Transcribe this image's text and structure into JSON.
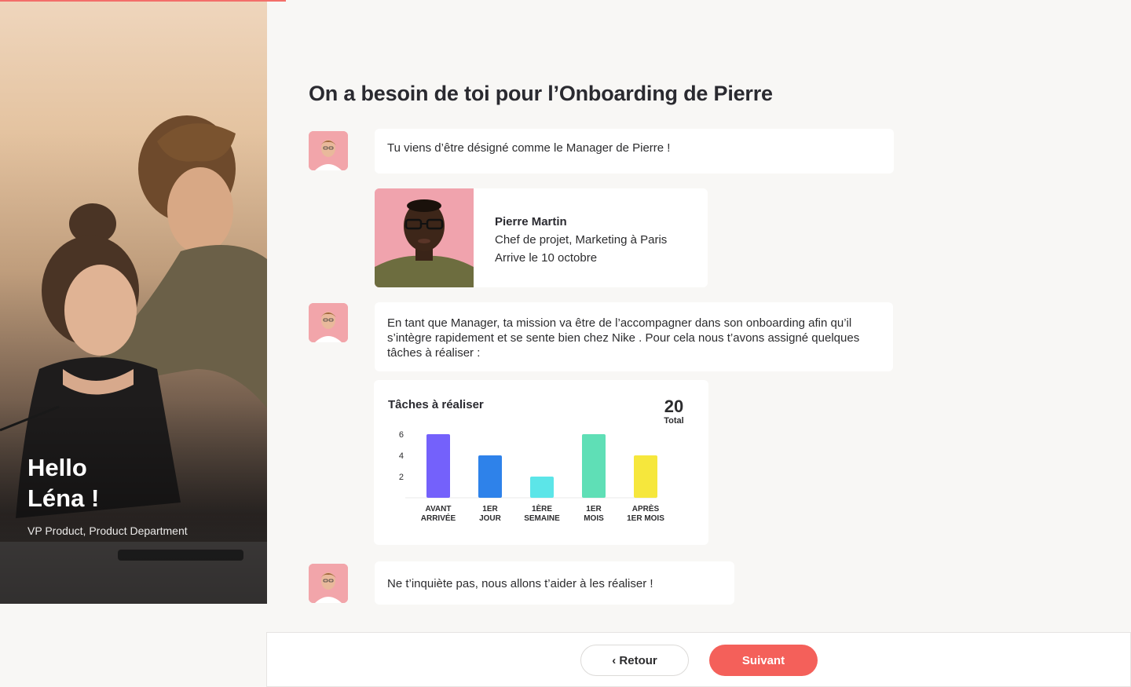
{
  "hero": {
    "greeting_line1": "Hello",
    "greeting_line2": "Léna !",
    "role": "VP Product, Product Department"
  },
  "main": {
    "title": "On a besoin de toi pour l’Onboarding de Pierre",
    "message1": "Tu viens d’être désigné comme le Manager de Pierre !",
    "profile": {
      "name": "Pierre Martin",
      "position": "Chef de projet, Marketing à Paris",
      "arrival": "Arrive le 10 octobre"
    },
    "message2": "En tant que Manager, ta mission va être de l’accompagner dans son onboarding afin qu’il s’intègre rapidement et se sente bien chez Nike . Pour cela nous t’avons assigné quelques tâches à réaliser :",
    "message3": "Ne t’inquiète pas, nous allons t’aider à les réaliser !"
  },
  "chart_card": {
    "title": "Tâches à réaliser",
    "total_value": "20",
    "total_label": "Total"
  },
  "chart_data": {
    "type": "bar",
    "title": "Tâches à réaliser",
    "categories": [
      [
        "AVANT",
        "ARRIVÉE"
      ],
      [
        "1ER",
        "JOUR"
      ],
      [
        "1ÈRE",
        "SEMAINE"
      ],
      [
        "1ER",
        "MOIS"
      ],
      [
        "APRÈS",
        "1ER MOIS"
      ]
    ],
    "values": [
      6,
      4,
      2,
      6,
      4
    ],
    "colors": [
      "#7461fb",
      "#2e82ea",
      "#5ce5e8",
      "#5fdfb6",
      "#f6e73c"
    ],
    "yticks": [
      2,
      4,
      6
    ],
    "ylim": [
      0,
      6
    ],
    "grid": false
  },
  "footer": {
    "back_label": "‹ Retour",
    "next_label": "Suivant"
  },
  "colors": {
    "accent": "#f4605a",
    "progress": "#f36f6a",
    "background": "#f8f7f5"
  }
}
